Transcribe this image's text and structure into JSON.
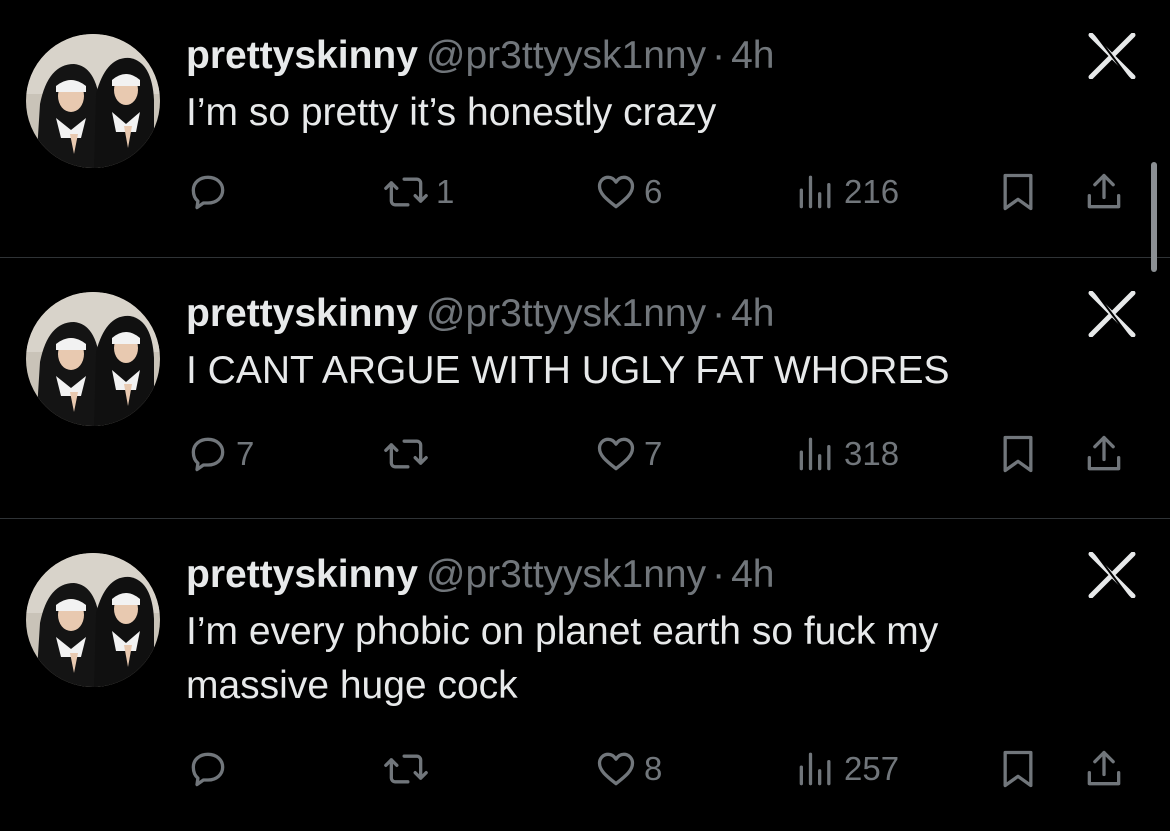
{
  "colors": {
    "background": "#000000",
    "primary_text": "#e7e9ea",
    "secondary_text": "#71767b",
    "divider": "#2f3336"
  },
  "tweets": [
    {
      "display_name": "prettyskinny",
      "handle": "@pr3ttyysk1nny",
      "separator": "·",
      "timestamp": "4h",
      "text": "I’m so pretty it’s honestly crazy",
      "replies": "",
      "retweets": "1",
      "likes": "6",
      "views": "216",
      "avatar_icon": "avatar-photo",
      "grok_icon": "grok-icon"
    },
    {
      "display_name": "prettyskinny",
      "handle": "@pr3ttyysk1nny",
      "separator": "·",
      "timestamp": "4h",
      "text": "I CANT ARGUE WITH UGLY FAT WHORES",
      "replies": "7",
      "retweets": "",
      "likes": "7",
      "views": "318",
      "avatar_icon": "avatar-photo",
      "grok_icon": "grok-icon"
    },
    {
      "display_name": "prettyskinny",
      "handle": "@pr3ttyysk1nny",
      "separator": "·",
      "timestamp": "4h",
      "text": "I’m every phobic on planet earth so fuck my massive huge cock",
      "replies": "",
      "retweets": "",
      "likes": "8",
      "views": "257",
      "avatar_icon": "avatar-photo",
      "grok_icon": "grok-icon"
    }
  ]
}
